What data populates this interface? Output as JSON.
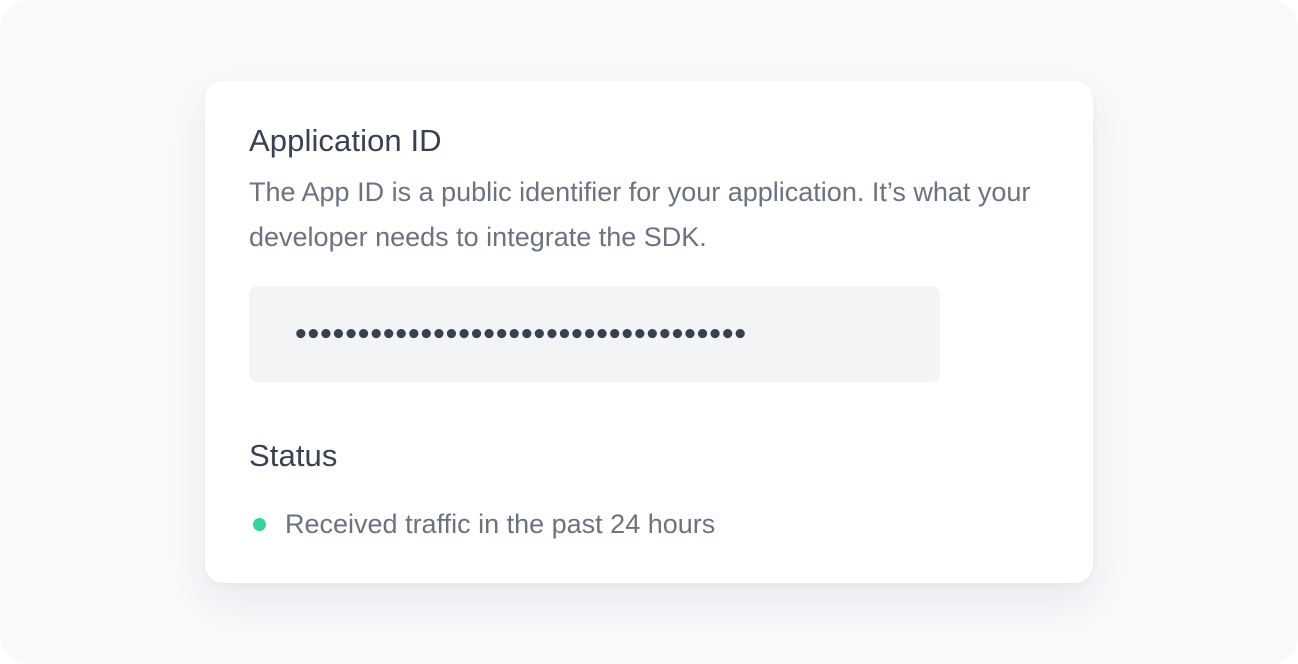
{
  "application_id": {
    "title": "Application ID",
    "description": "The App ID is a public identifier for your application. It’s what your developer needs to integrate the SDK.",
    "masked_value": "••••••••••••••••••••••••••••••••••••"
  },
  "status": {
    "title": "Status",
    "text": "Received traffic in the past 24 hours",
    "indicator_color": "#34d399"
  }
}
